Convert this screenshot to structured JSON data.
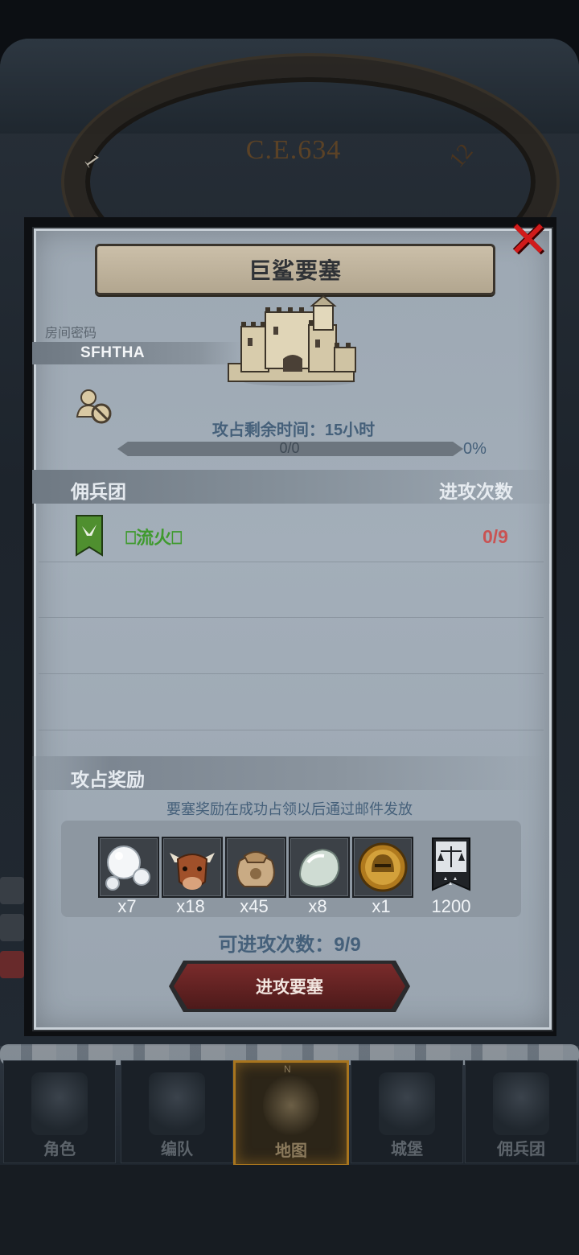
{
  "background": {
    "era_label": "C.E.634",
    "clock_num_left": "1",
    "clock_num_right": "12"
  },
  "dialog": {
    "title": "巨鲨要塞",
    "room_code_label": "房间密码",
    "room_code": "SFHTHA",
    "time_remaining_label": "攻占剩余时间：15小时",
    "progress_text": "0/0",
    "progress_percent": "0%",
    "progress_fraction": 0,
    "mercenaries_header": "佣兵团",
    "attacks_header": "进攻次数",
    "guilds": [
      {
        "name": "⎕流火⎕",
        "attacks": "0/9"
      }
    ],
    "rewards_header": "攻占奖励",
    "rewards_note": "要塞奖励在成功占领以后通过邮件发放",
    "rewards": [
      {
        "icon": "pearls-icon",
        "count": "x7"
      },
      {
        "icon": "cow-icon",
        "count": "x18"
      },
      {
        "icon": "sack-icon",
        "count": "x45"
      },
      {
        "icon": "gem-stone-icon",
        "count": "x8"
      },
      {
        "icon": "helmet-medal-icon",
        "count": "x1"
      },
      {
        "icon": "justice-banner-icon",
        "count": "1200"
      }
    ],
    "attempts_label": "可进攻次数：9/9",
    "attack_button_label": "进攻要塞",
    "close_icon": "close-icon"
  },
  "bottom_nav": {
    "items": [
      {
        "label": "角色",
        "icon": "knight-icon",
        "active": false
      },
      {
        "label": "编队",
        "icon": "formation-icon",
        "active": false
      },
      {
        "label": "地图",
        "icon": "compass-map-icon",
        "active": true
      },
      {
        "label": "城堡",
        "icon": "castle-icon",
        "active": false
      },
      {
        "label": "佣兵团",
        "icon": "mercenary-icon",
        "active": false
      }
    ],
    "compass_letter": "N"
  },
  "colors": {
    "accent_blue": "#45607a",
    "danger_red": "#c95353",
    "guild_green": "#3f9a2e",
    "close_red": "#d11b1b",
    "active_gold": "#a8751e"
  }
}
